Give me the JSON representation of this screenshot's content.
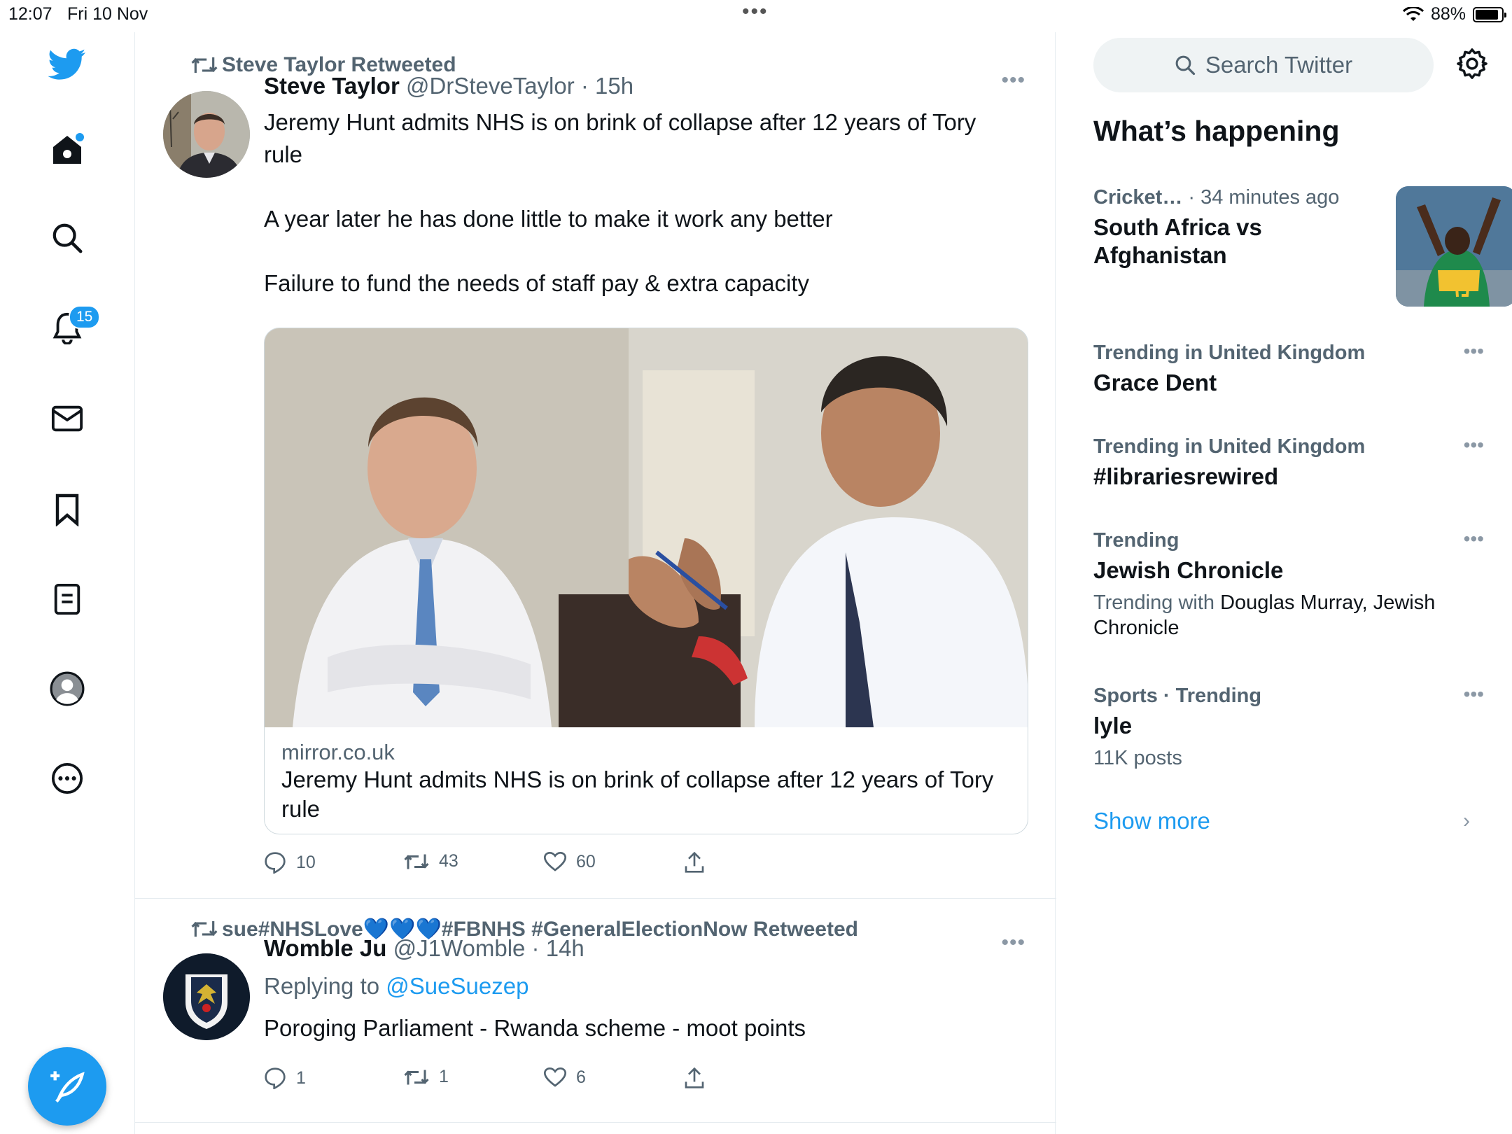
{
  "status_bar": {
    "time": "12:07",
    "date": "Fri 10 Nov",
    "battery": "88%"
  },
  "nav": {
    "notifications_badge": "15"
  },
  "colors": {
    "accent": "#1d9bf0",
    "text_primary": "#0f1419",
    "text_secondary": "#536471"
  },
  "tweets": [
    {
      "retweeted_by": "Steve Taylor Retweeted",
      "name": "Steve Taylor",
      "handle": "@DrSteveTaylor",
      "time": "15h",
      "text_lines": [
        "Jeremy Hunt admits NHS is on brink of collapse after 12 years of Tory rule",
        "A year later he has done little to make it work any better",
        "Failure to fund the needs of staff pay & extra capacity"
      ],
      "card": {
        "domain": "mirror.co.uk",
        "title": "Jeremy Hunt admits NHS is on brink of collapse after 12 years of Tory rule"
      },
      "replies": "10",
      "retweets": "43",
      "likes": "60"
    },
    {
      "retweeted_by": "sue#NHSLove💙💙💙#FBNHS #GeneralElectionNow Retweeted",
      "name": "Womble Ju",
      "handle": "@J1Womble",
      "time": "14h",
      "replying_prefix": "Replying to",
      "replying_to": "@SueSuezep",
      "text": "Poroging Parliament - Rwanda scheme - moot points",
      "replies": "1",
      "retweets": "1",
      "likes": "6"
    }
  ],
  "sidebar": {
    "search_placeholder": "Search Twitter",
    "section_title": "What’s happening",
    "trends": [
      {
        "context": "Cricket…",
        "context_time": "34 minutes ago",
        "name": "South Africa vs Afghanistan"
      },
      {
        "context": "Trending in United Kingdom",
        "name": "Grace Dent"
      },
      {
        "context": "Trending in United Kingdom",
        "name": "#librariesrewired"
      },
      {
        "context": "Trending",
        "name": "Jewish Chronicle",
        "sub_prefix": "Trending with",
        "sub_value": "Douglas Murray, Jewish Chronicle"
      },
      {
        "context": "Sports · Trending",
        "name": "lyle",
        "count": "11K posts"
      }
    ],
    "show_more": "Show more"
  }
}
